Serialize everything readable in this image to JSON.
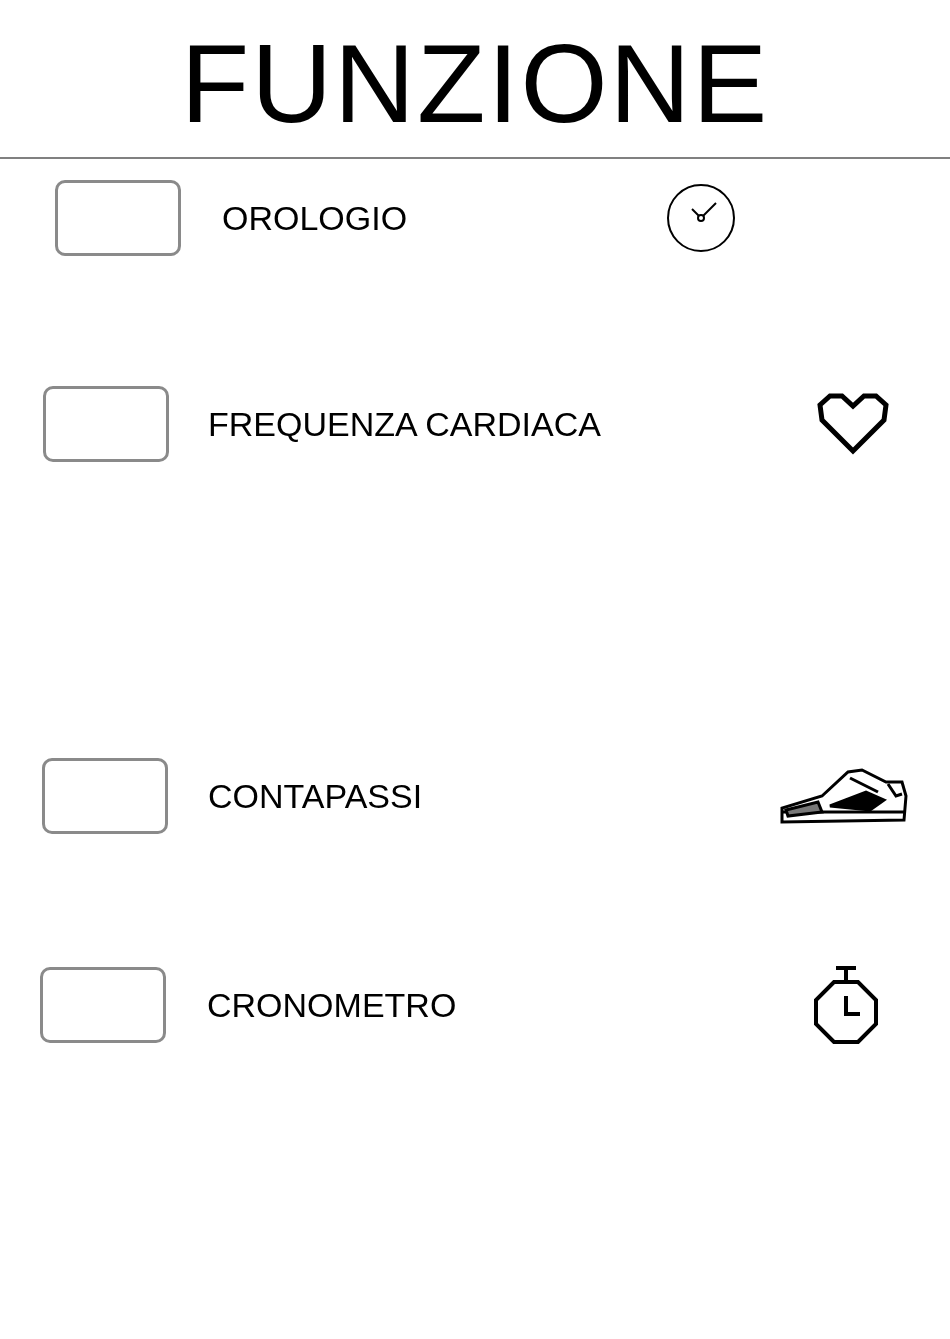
{
  "title": "FUNZIONE",
  "functions": [
    {
      "label": "OROLOGIO",
      "checked": false
    },
    {
      "label": "FREQUENZA CARDIACA",
      "checked": false
    },
    {
      "label": "CONTAPASSI",
      "checked": false
    },
    {
      "label": "CRONOMETRO",
      "checked": false
    }
  ]
}
